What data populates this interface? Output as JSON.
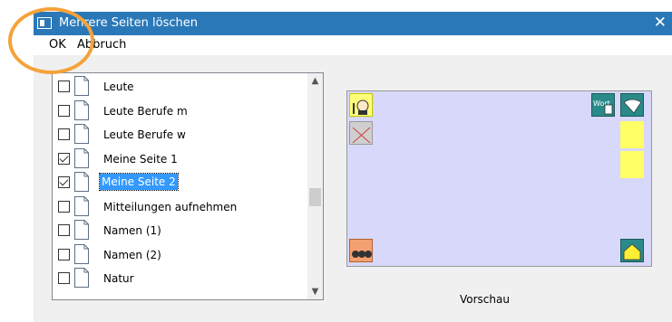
{
  "window": {
    "title": "Mehrere Seiten löschen",
    "close_glyph": "✕"
  },
  "menu": {
    "ok_label": "OK",
    "cancel_label": "Abbruch"
  },
  "pages": [
    {
      "label": "Leute",
      "checked": false,
      "selected": false
    },
    {
      "label": "Leute Berufe m",
      "checked": false,
      "selected": false
    },
    {
      "label": "Leute Berufe w",
      "checked": false,
      "selected": false
    },
    {
      "label": "Meine Seite 1",
      "checked": true,
      "selected": false
    },
    {
      "label": "Meine Seite 2",
      "checked": true,
      "selected": true
    },
    {
      "label": "Mitteilungen aufnehmen",
      "checked": false,
      "selected": false
    },
    {
      "label": "Namen (1)",
      "checked": false,
      "selected": false
    },
    {
      "label": "Namen (2)",
      "checked": false,
      "selected": false
    },
    {
      "label": "Natur",
      "checked": false,
      "selected": false
    }
  ],
  "preview": {
    "label": "Vorschau",
    "tile_word_label": "Wort"
  },
  "colors": {
    "titlebar": "#2a78b8",
    "selection": "#3399ff",
    "preview_bg": "#d8d8fa",
    "highlight_circle": "#f5a23a"
  }
}
